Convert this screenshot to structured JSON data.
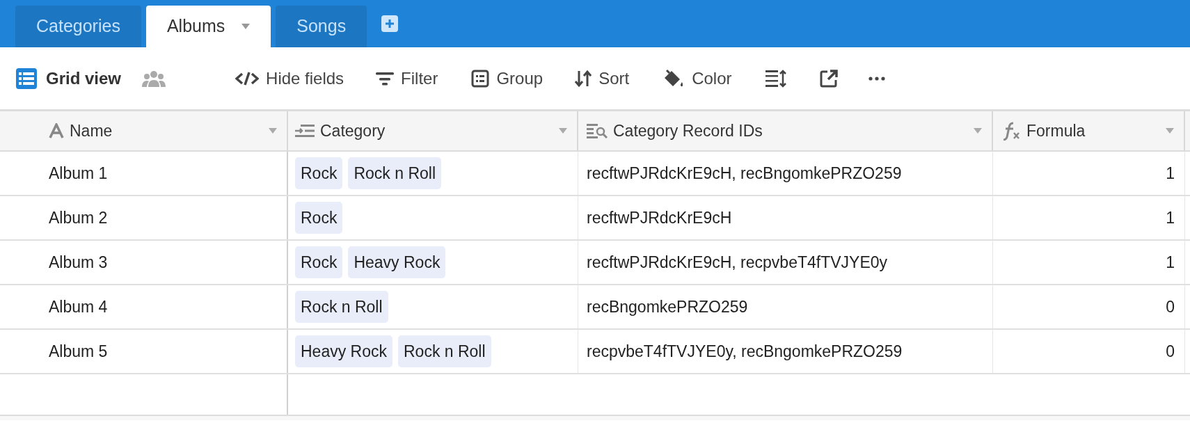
{
  "tabs": [
    {
      "label": "Categories",
      "selected": false
    },
    {
      "label": "Albums",
      "selected": true
    },
    {
      "label": "Songs",
      "selected": false
    }
  ],
  "toolbar": {
    "view_name": "Grid view",
    "buttons": [
      {
        "kind": "hide",
        "label": "Hide fields"
      },
      {
        "kind": "filter",
        "label": "Filter"
      },
      {
        "kind": "group",
        "label": "Group"
      },
      {
        "kind": "sort",
        "label": "Sort"
      },
      {
        "kind": "color",
        "label": "Color"
      },
      {
        "kind": "rowheight"
      },
      {
        "kind": "share"
      },
      {
        "kind": "more"
      }
    ]
  },
  "table": {
    "columns": [
      {
        "kind": "text",
        "label": "Name"
      },
      {
        "kind": "link",
        "label": "Category"
      },
      {
        "kind": "lookup",
        "label": "Category Record IDs"
      },
      {
        "kind": "formula",
        "label": "Formula"
      }
    ],
    "rows": [
      {
        "name": "Album 1",
        "category": [
          "Rock",
          "Rock n Roll"
        ],
        "record_ids": "recftwPJRdcKrE9cH, recBngomkePRZO259",
        "formula": "1"
      },
      {
        "name": "Album 2",
        "category": [
          "Rock"
        ],
        "record_ids": "recftwPJRdcKrE9cH",
        "formula": "1"
      },
      {
        "name": "Album 3",
        "category": [
          "Rock",
          "Heavy Rock"
        ],
        "record_ids": "recftwPJRdcKrE9cH, recpvbeT4fTVJYE0y",
        "formula": "1"
      },
      {
        "name": "Album 4",
        "category": [
          "Rock n Roll"
        ],
        "record_ids": "recBngomkePRZO259",
        "formula": "0"
      },
      {
        "name": "Album 5",
        "category": [
          "Heavy Rock",
          "Rock n Roll"
        ],
        "record_ids": "recpvbeT4fTVJYE0y, recBngomkePRZO259",
        "formula": "0"
      }
    ]
  }
}
